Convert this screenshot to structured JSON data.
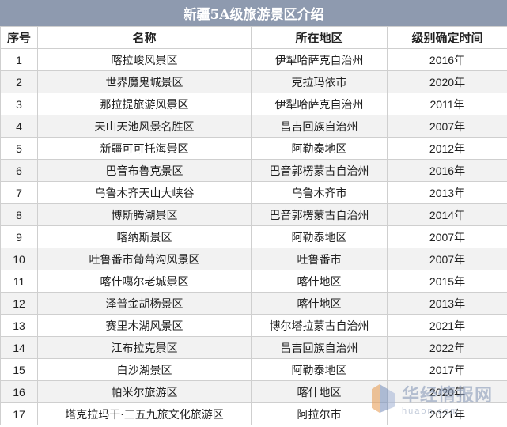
{
  "title": "新疆5A级旅游景区介绍",
  "columns": [
    "序号",
    "名称",
    "所在地区",
    "级别确定时间"
  ],
  "rows": [
    {
      "no": "1",
      "name": "喀拉峻风景区",
      "region": "伊犁哈萨克自治州",
      "year": "2016年"
    },
    {
      "no": "2",
      "name": "世界魔鬼城景区",
      "region": "克拉玛依市",
      "year": "2020年"
    },
    {
      "no": "3",
      "name": "那拉提旅游风景区",
      "region": "伊犁哈萨克自治州",
      "year": "2011年"
    },
    {
      "no": "4",
      "name": "天山天池风景名胜区",
      "region": "昌吉回族自治州",
      "year": "2007年"
    },
    {
      "no": "5",
      "name": "新疆可可托海景区",
      "region": "阿勒泰地区",
      "year": "2012年"
    },
    {
      "no": "6",
      "name": "巴音布鲁克景区",
      "region": "巴音郭楞蒙古自治州",
      "year": "2016年"
    },
    {
      "no": "7",
      "name": "乌鲁木齐天山大峡谷",
      "region": "乌鲁木齐市",
      "year": "2013年"
    },
    {
      "no": "8",
      "name": "博斯腾湖景区",
      "region": "巴音郭楞蒙古自治州",
      "year": "2014年"
    },
    {
      "no": "9",
      "name": "喀纳斯景区",
      "region": "阿勒泰地区",
      "year": "2007年"
    },
    {
      "no": "10",
      "name": "吐鲁番市葡萄沟风景区",
      "region": "吐鲁番市",
      "year": "2007年"
    },
    {
      "no": "11",
      "name": "喀什噶尔老城景区",
      "region": "喀什地区",
      "year": "2015年"
    },
    {
      "no": "12",
      "name": "泽普金胡杨景区",
      "region": "喀什地区",
      "year": "2013年"
    },
    {
      "no": "13",
      "name": "赛里木湖风景区",
      "region": "博尔塔拉蒙古自治州",
      "year": "2021年"
    },
    {
      "no": "14",
      "name": "江布拉克景区",
      "region": "昌吉回族自治州",
      "year": "2022年"
    },
    {
      "no": "15",
      "name": "白沙湖景区",
      "region": "阿勒泰地区",
      "year": "2017年"
    },
    {
      "no": "16",
      "name": "帕米尔旅游区",
      "region": "喀什地区",
      "year": "2020年"
    },
    {
      "no": "17",
      "name": "塔克拉玛干·三五九旅文化旅游区",
      "region": "阿拉尔市",
      "year": "2021年"
    }
  ],
  "watermark": {
    "cn": "华经情报网",
    "en": "huaon.com"
  },
  "colors": {
    "title_bg": "#8e9aaf",
    "stripe": "#f2f2f2",
    "border": "#cfcfcf"
  }
}
